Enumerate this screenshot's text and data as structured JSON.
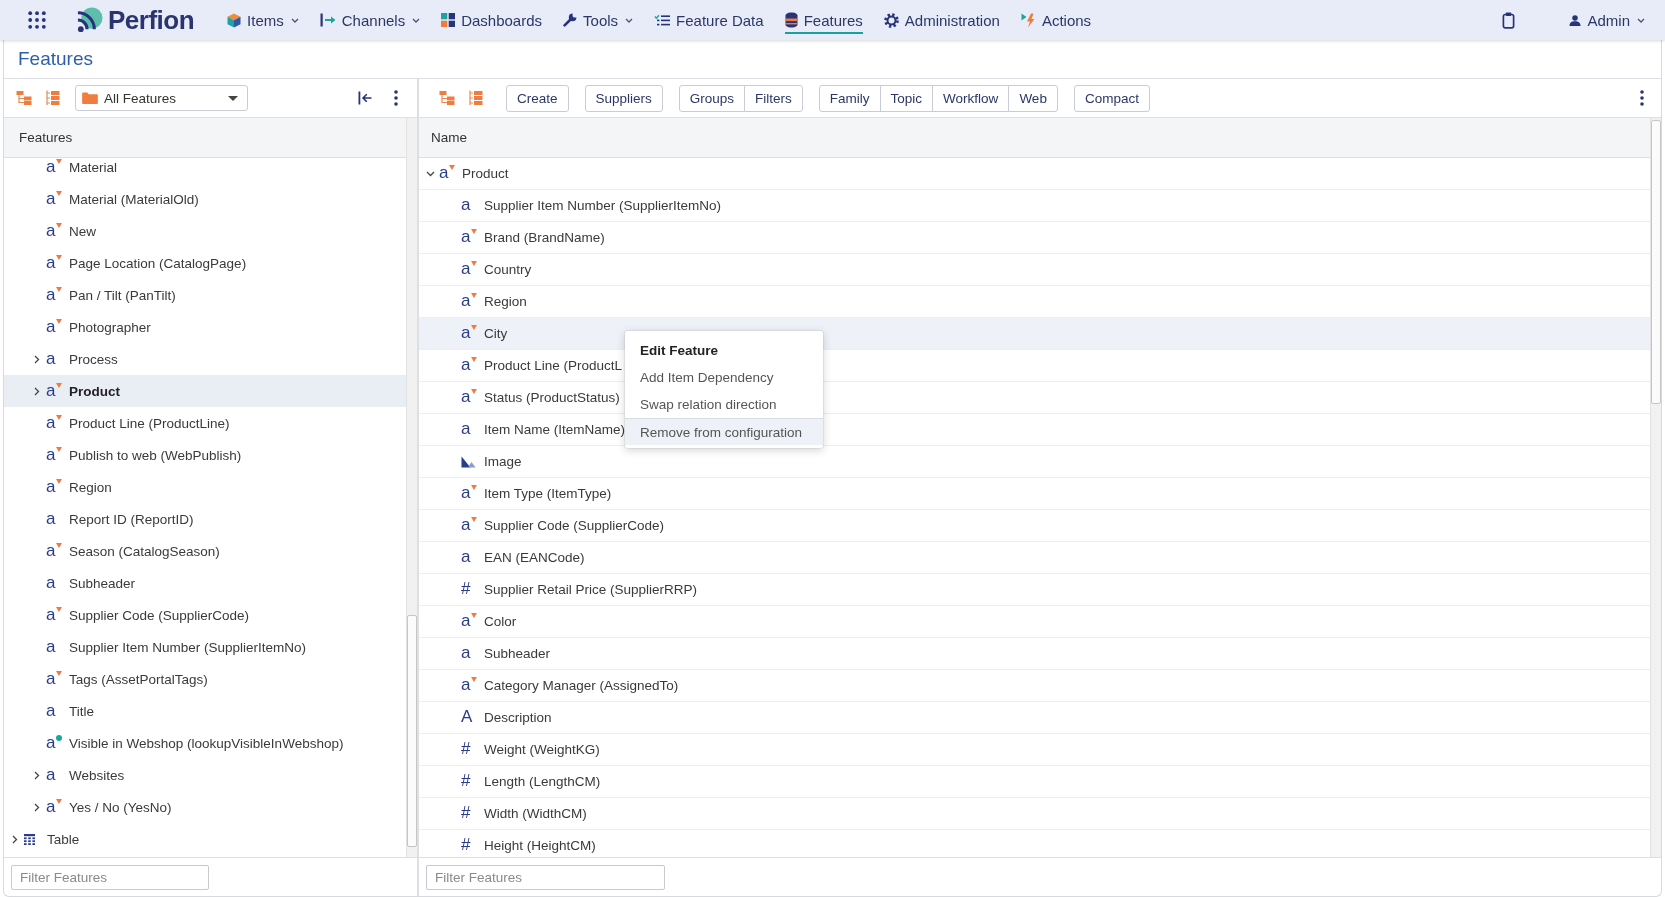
{
  "top_nav": {
    "brand": "Perfion",
    "items": [
      {
        "label": "Items",
        "dropdown": true,
        "selected": false
      },
      {
        "label": "Channels",
        "dropdown": true,
        "selected": false
      },
      {
        "label": "Dashboards",
        "dropdown": false,
        "selected": false
      },
      {
        "label": "Tools",
        "dropdown": true,
        "selected": false
      },
      {
        "label": "Feature Data",
        "dropdown": false,
        "selected": false
      },
      {
        "label": "Features",
        "dropdown": false,
        "selected": true
      },
      {
        "label": "Administration",
        "dropdown": false,
        "selected": false
      },
      {
        "label": "Actions",
        "dropdown": false,
        "selected": false
      }
    ],
    "user_menu": {
      "label": "Admin",
      "dropdown": true
    }
  },
  "page_title": "Features",
  "left_panel": {
    "view_dropdown": {
      "value": "All Features"
    },
    "tree_header": "Features",
    "tree": [
      {
        "children": [
          {
            "label": "Material",
            "kind": "list",
            "glyph": "a",
            "selected": false
          },
          {
            "label": "Material (MaterialOld)",
            "kind": "list",
            "glyph": "a",
            "selected": false
          },
          {
            "label": "New",
            "kind": "list",
            "glyph": "a",
            "selected": false
          },
          {
            "label": "Page Location (CatalogPage)",
            "kind": "list",
            "glyph": "a",
            "selected": false
          },
          {
            "label": "Pan / Tilt (PanTilt)",
            "kind": "list",
            "glyph": "a",
            "selected": false
          },
          {
            "label": "Photographer",
            "kind": "list",
            "glyph": "a",
            "selected": false
          },
          {
            "label": "Process",
            "kind": "text",
            "glyph": "a",
            "expanded": false,
            "selected": false
          },
          {
            "label": "Product",
            "kind": "list",
            "glyph": "a",
            "expanded": false,
            "selected": true
          },
          {
            "label": "Product Line (ProductLine)",
            "kind": "list",
            "glyph": "a",
            "selected": false
          },
          {
            "label": "Publish to web (WebPublish)",
            "kind": "list",
            "glyph": "a",
            "selected": false
          },
          {
            "label": "Region",
            "kind": "list",
            "glyph": "a",
            "selected": false
          },
          {
            "label": "Report ID (ReportID)",
            "kind": "text",
            "glyph": "a",
            "selected": false
          },
          {
            "label": "Season (CatalogSeason)",
            "kind": "list",
            "glyph": "a",
            "selected": false
          },
          {
            "label": "Subheader",
            "kind": "text",
            "glyph": "a",
            "selected": false
          },
          {
            "label": "Supplier Code (SupplierCode)",
            "kind": "list",
            "glyph": "a",
            "selected": false
          },
          {
            "label": "Supplier Item Number (SupplierItemNo)",
            "kind": "text",
            "glyph": "a",
            "selected": false
          },
          {
            "label": "Tags (AssetPortalTags)",
            "kind": "list",
            "glyph": "a",
            "selected": false
          },
          {
            "label": "Title",
            "kind": "text",
            "glyph": "a",
            "selected": false
          },
          {
            "label": "Visible in Webshop (lookupVisibleInWebshop)",
            "kind": "lookup",
            "glyph": "a",
            "selected": false
          },
          {
            "label": "Websites",
            "kind": "text",
            "glyph": "a",
            "expanded": false,
            "selected": false
          },
          {
            "label": "Yes / No (YesNo)",
            "kind": "list",
            "glyph": "a",
            "expanded": false,
            "selected": false
          }
        ]
      },
      {
        "label": "Table",
        "kind": "table",
        "expanded": false,
        "selected": false
      }
    ],
    "filter": {
      "placeholder": "Filter Features"
    }
  },
  "right_panel": {
    "button_groups": [
      [
        "Create"
      ],
      [
        "Suppliers"
      ],
      [
        "Groups",
        "Filters"
      ],
      [
        "Family",
        "Topic",
        "Workflow",
        "Web"
      ],
      [
        "Compact"
      ]
    ],
    "column_header": "Name",
    "rows": [
      {
        "label": "Product",
        "kind": "list",
        "glyph": "a",
        "expanded": true,
        "selected": false,
        "children": [
          {
            "label": "Supplier Item Number (SupplierItemNo)",
            "kind": "text",
            "glyph": "a",
            "selected": false
          },
          {
            "label": "Brand (BrandName)",
            "kind": "list",
            "glyph": "a",
            "selected": false
          },
          {
            "label": "Country",
            "kind": "list",
            "glyph": "a",
            "selected": false
          },
          {
            "label": "Region",
            "kind": "list",
            "glyph": "a",
            "selected": false
          },
          {
            "label": "City",
            "kind": "list",
            "glyph": "a",
            "selected": true
          },
          {
            "label": "Product Line (ProductL",
            "kind": "list",
            "glyph": "a",
            "selected": false
          },
          {
            "label": "Status (ProductStatus)",
            "kind": "list",
            "glyph": "a",
            "selected": false
          },
          {
            "label": "Item Name (ItemName)",
            "kind": "text",
            "glyph": "a",
            "selected": false
          },
          {
            "label": "Image",
            "kind": "image",
            "selected": false
          },
          {
            "label": "Item Type (ItemType)",
            "kind": "list",
            "glyph": "a",
            "selected": false
          },
          {
            "label": "Supplier Code (SupplierCode)",
            "kind": "list",
            "glyph": "a",
            "selected": false
          },
          {
            "label": "EAN (EANCode)",
            "kind": "text",
            "glyph": "a",
            "selected": false
          },
          {
            "label": "Supplier Retail Price (SupplierRRP)",
            "kind": "number",
            "glyph": "#",
            "selected": false
          },
          {
            "label": "Color",
            "kind": "list",
            "glyph": "a",
            "selected": false
          },
          {
            "label": "Subheader",
            "kind": "text",
            "glyph": "a",
            "selected": false
          },
          {
            "label": "Category Manager (AssignedTo)",
            "kind": "list",
            "glyph": "a",
            "selected": false
          },
          {
            "label": "Description",
            "kind": "rich",
            "glyph": "A",
            "selected": false
          },
          {
            "label": "Weight (WeightKG)",
            "kind": "number",
            "glyph": "#",
            "selected": false
          },
          {
            "label": "Length (LengthCM)",
            "kind": "number",
            "glyph": "#",
            "selected": false
          },
          {
            "label": "Width (WidthCM)",
            "kind": "number",
            "glyph": "#",
            "selected": false
          },
          {
            "label": "Height (HeightCM)",
            "kind": "number",
            "glyph": "#",
            "selected": false
          }
        ]
      }
    ],
    "context_menu": {
      "items": [
        {
          "label": "Edit Feature",
          "default": true,
          "divider_before": false,
          "selected": false
        },
        {
          "label": "Add Item Dependency",
          "default": false,
          "divider_before": false,
          "selected": false
        },
        {
          "label": "Swap relation direction",
          "default": false,
          "divider_before": false,
          "selected": false
        },
        {
          "label": "Remove from configuration",
          "default": false,
          "divider_before": true,
          "selected": true
        }
      ]
    },
    "filter": {
      "placeholder": "Filter Features"
    }
  }
}
